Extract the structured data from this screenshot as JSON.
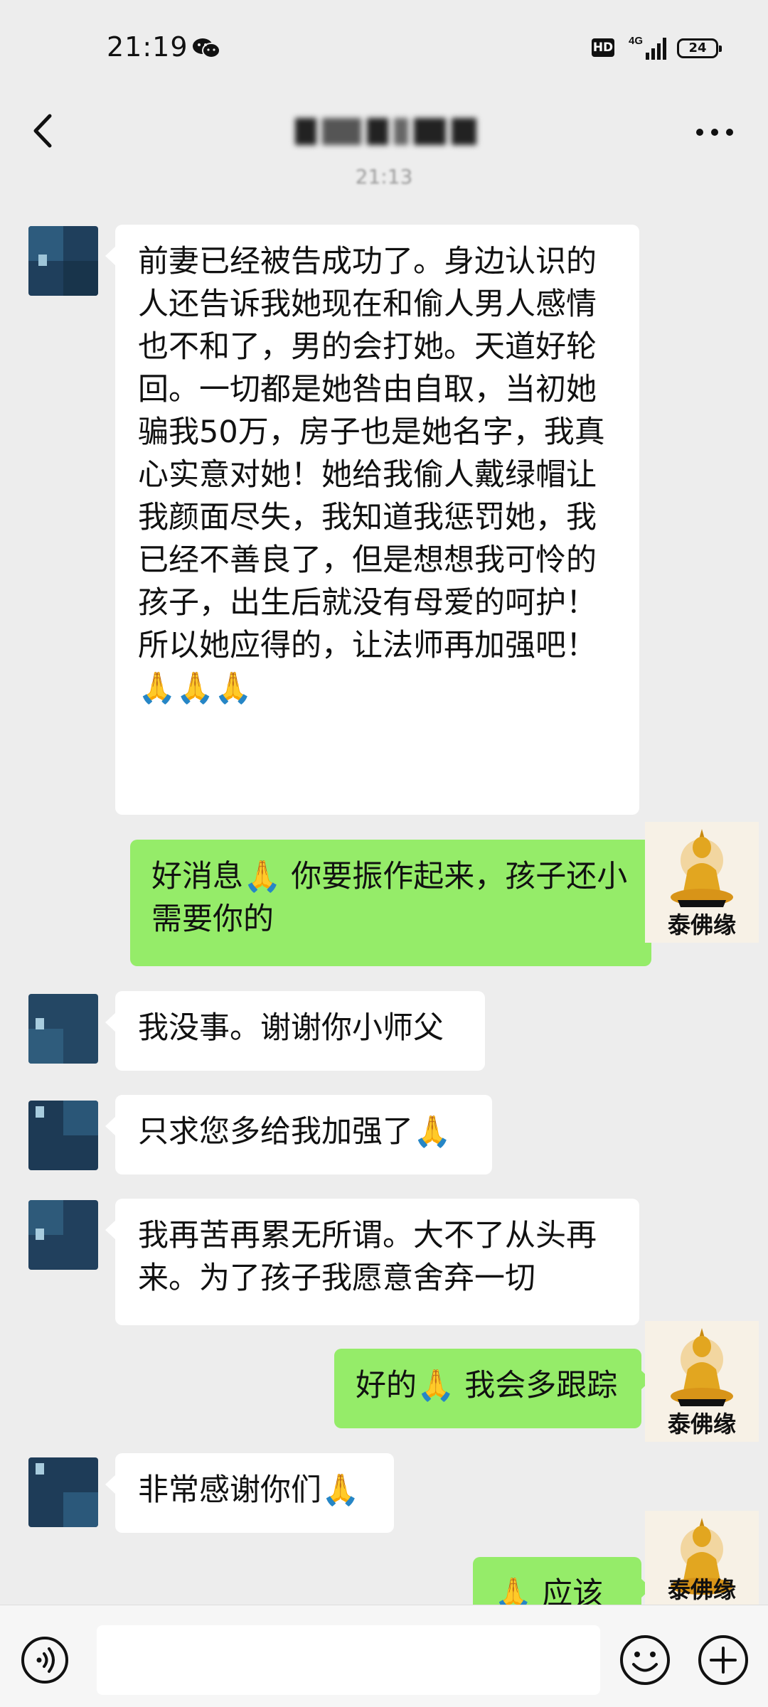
{
  "status_bar": {
    "time": "21:19",
    "network_badge": "HD",
    "network_type": "4G",
    "battery": "24",
    "icons": [
      "wechat-icon",
      "signal-icon",
      "battery-icon"
    ]
  },
  "header": {
    "title": "",
    "back_icon": "chevron-left-icon",
    "more_icon": "more-icon"
  },
  "timestamp": "21:13",
  "messages": [
    {
      "side": "in",
      "text": "前妻已经被告成功了。身边认识的人还告诉我她现在和偷人男人感情也不和了，男的会打她。天道好轮回。一切都是她咎由自取，当初她骗我50万，房子也是她名字，我真心实意对她！她给我偷人戴绿帽让我颜面尽失，我知道我惩罚她，我已经不善良了，但是想想我可怜的孩子，出生后就没有母爱的呵护！所以她应得的，让法师再加强吧！🙏🙏🙏"
    },
    {
      "side": "out",
      "text": "好消息🙏 你要振作起来，孩子还小需要你的"
    },
    {
      "side": "in",
      "text": "我没事。谢谢你小师父"
    },
    {
      "side": "in",
      "text": "只求您多给我加强了🙏"
    },
    {
      "side": "in",
      "text": "我再苦再累无所谓。大不了从头再来。为了孩子我愿意舍弃一切"
    },
    {
      "side": "out",
      "text": "好的🙏 我会多跟踪"
    },
    {
      "side": "in",
      "text": "非常感谢你们🙏"
    },
    {
      "side": "out",
      "text": "🙏 应该的"
    }
  ],
  "self_avatar_label": "泰佛缘",
  "bottom_bar": {
    "icons": [
      "voice-icon",
      "emoji-icon",
      "plus-icon"
    ]
  },
  "colors": {
    "background": "#ededed",
    "incoming_bubble": "#ffffff",
    "outgoing_bubble": "#95ec69"
  }
}
